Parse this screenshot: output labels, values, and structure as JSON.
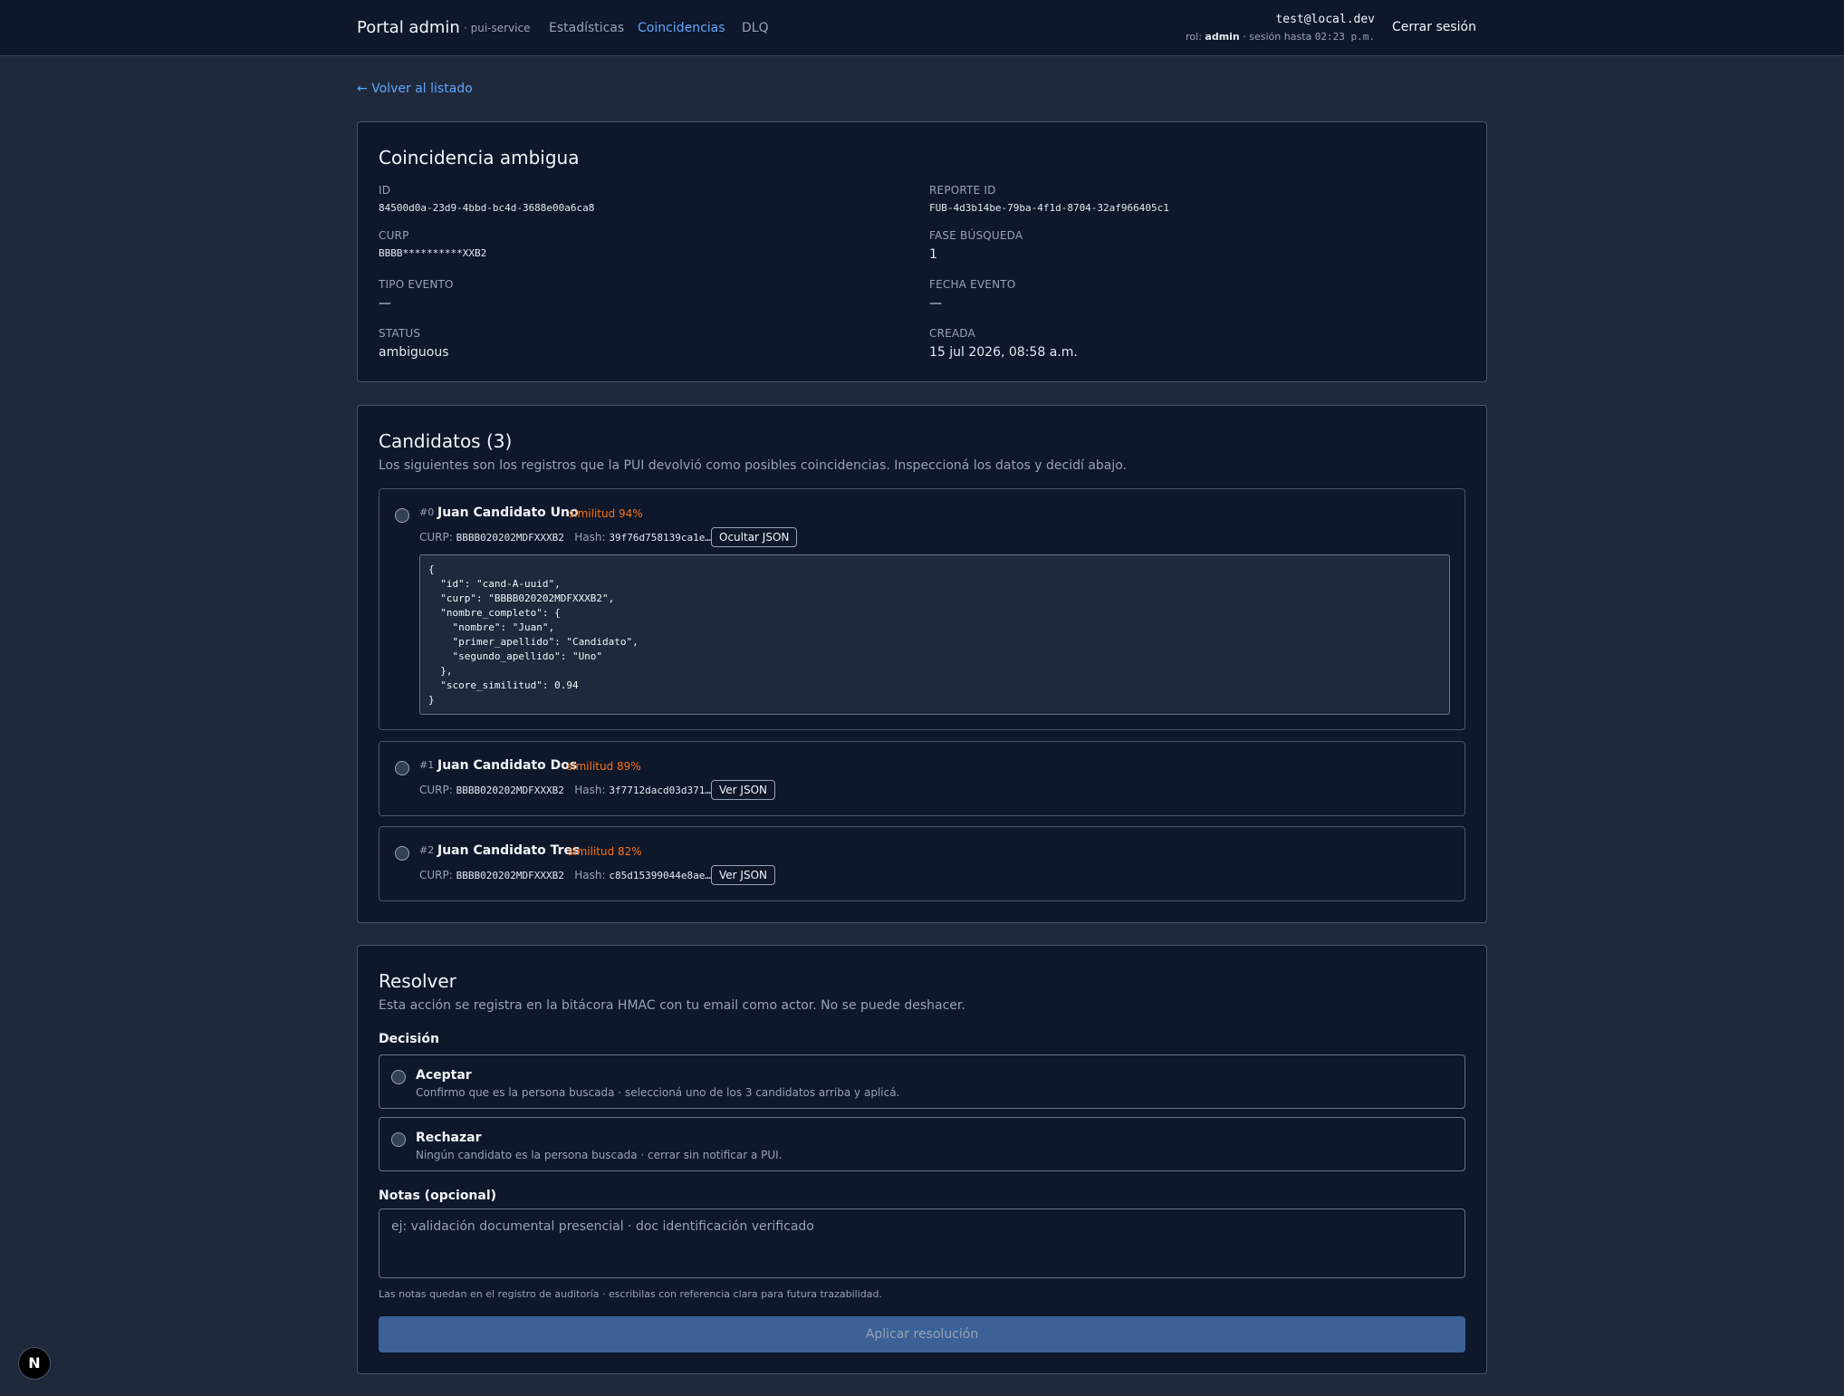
{
  "nav": {
    "brand": "Portal admin",
    "service": "· pui-service",
    "links": [
      "Estadísticas",
      "Coincidencias",
      "DLQ"
    ],
    "active": "Coincidencias",
    "user_email": "test@local.dev",
    "role_label": "rol:",
    "role": "admin",
    "session_label": "· sesión hasta",
    "session_until": "02:23 p.m.",
    "logout": "Cerrar sesión"
  },
  "back_link": "← Volver al listado",
  "detail": {
    "title": "Coincidencia ambigua",
    "fields": [
      {
        "label": "ID",
        "value": "84500d0a-23d9-4bbd-bc4d-3688e00a6ca8"
      },
      {
        "label": "Reporte ID",
        "value": "FUB-4d3b14be-79ba-4f1d-8704-32af966405c1"
      },
      {
        "label": "CURP",
        "value": "BBBB**********XXB2"
      },
      {
        "label": "Fase búsqueda",
        "value": "1"
      },
      {
        "label": "Tipo evento",
        "value": "—"
      },
      {
        "label": "Fecha evento",
        "value": "—"
      },
      {
        "label": "Status",
        "value": "ambiguous"
      },
      {
        "label": "Creada",
        "value": "15 jul 2026, 08:58 a.m."
      }
    ]
  },
  "candidates": {
    "title": "Candidatos (3)",
    "subtitle": "Los siguientes son los registros que la PUI devolvió como posibles coincidencias. Inspeccioná los datos y decidí abajo.",
    "curp_label": "CURP:",
    "hash_label": "Hash:",
    "items": [
      {
        "index": "#0",
        "name": "Juan Candidato Uno",
        "similarity": "similitud 94%",
        "curp": "BBBB020202MDFXXXB2",
        "hash": "39f76d758139ca1e…",
        "button": "Ocultar JSON"
      },
      {
        "index": "#1",
        "name": "Juan Candidato Dos",
        "similarity": "similitud 89%",
        "curp": "BBBB020202MDFXXXB2",
        "hash": "3f7712dacd03d371…",
        "button": "Ver JSON"
      },
      {
        "index": "#2",
        "name": "Juan Candidato Tres",
        "similarity": "similitud 82%",
        "curp": "BBBB020202MDFXXXB2",
        "hash": "c85d15399044e8ae…",
        "button": "Ver JSON"
      }
    ],
    "json": "{\n  \"id\": \"cand-A-uuid\",\n  \"curp\": \"BBBB020202MDFXXXB2\",\n  \"nombre_completo\": {\n    \"nombre\": \"Juan\",\n    \"primer_apellido\": \"Candidato\",\n    \"segundo_apellido\": \"Uno\"\n  },\n  \"score_similitud\": 0.94\n}"
  },
  "resolver": {
    "title": "Resolver",
    "subtitle": "Esta acción se registra en la bitácora HMAC con tu email como actor. No se puede deshacer.",
    "decision_label": "Decisión",
    "options": [
      {
        "title": "Aceptar",
        "desc": "Confirmo que es la persona buscada · seleccioná uno de los 3 candidatos arriba y aplicá."
      },
      {
        "title": "Rechazar",
        "desc": "Ningún candidato es la persona buscada · cerrar sin notificar a PUI."
      }
    ],
    "notes_label": "Notas (opcional)",
    "notes_placeholder": "ej: validación documental presencial · doc identificación verificado",
    "notes_hint": "Las notas quedan en el registro de auditoría · escribilas con referencia clara para futura trazabilidad.",
    "apply": "Aplicar resolución"
  },
  "dev_badge": "N"
}
